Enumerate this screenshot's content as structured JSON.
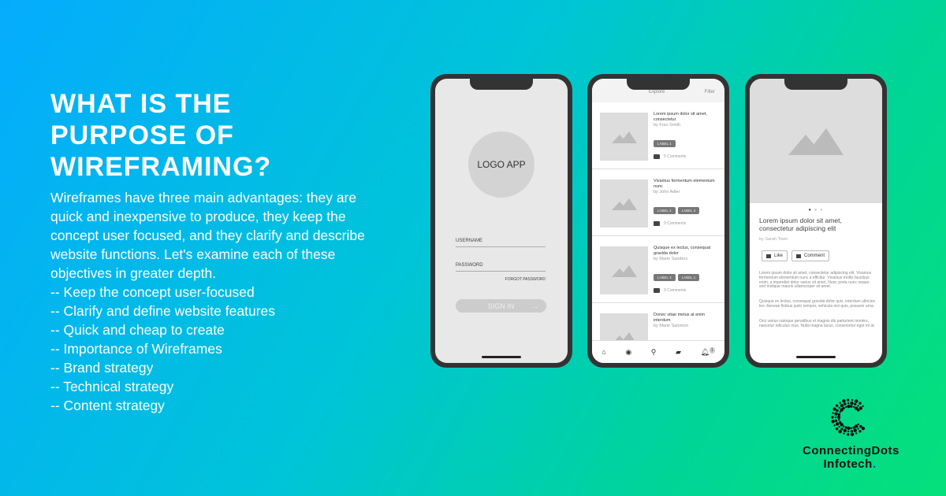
{
  "heading": "What is the purpose of wireframing?",
  "intro": "Wireframes have three main advantages: they are quick and inexpensive to produce, they keep the concept user focused, and they clarify and describe website functions. Let's examine each of these objectives in greater depth.",
  "points": [
    "-- Keep the concept user-focused",
    "-- Clarify and define website features",
    "-- Quick and cheap to create",
    "-- Importance of Wireframes",
    "-- Brand strategy",
    "-- Technical strategy",
    "-- Content strategy"
  ],
  "phone1": {
    "logo": "LOGO APP",
    "username": "USERNAME",
    "password": "PASSWORD",
    "forgot": "FORGOT PASSWORD",
    "signin": "SIGN IN",
    "arrow": "→"
  },
  "phone2": {
    "tab": "Explore",
    "filter": "Filter",
    "cards": [
      {
        "title": "Lorem ipsum dolor sit amet, consectetur",
        "by": "by Fran Smith",
        "labels": [
          "LABEL 1"
        ],
        "comments": "5 Comments"
      },
      {
        "title": "Vivamus fermentum elementum nunc",
        "by": "by John Adler",
        "labels": [
          "LABEL 2",
          "LABEL 3"
        ],
        "comments": "0 Comments"
      },
      {
        "title": "Quisque ex lectus, consequat gravida dolor",
        "by": "by Marie Sanders",
        "labels": [
          "LABEL 3",
          "LABEL 1"
        ],
        "comments": "0 Comments"
      },
      {
        "title": "Donec vitae metus at enim interdum",
        "by": "by Marie Salomon",
        "labels": [
          "",
          ""
        ],
        "comments": ""
      }
    ],
    "badge": "1"
  },
  "phone3": {
    "title": "Lorem ipsum dolor sit amet, consectetur adipiscing elit",
    "by": "by Sarah Town",
    "like": "Like",
    "comment": "Comment",
    "paragraphs": [
      "Lorem ipsum dolor sit amet, consectetur adipiscing elit. Vivamus fermentum elementum nunc a efficitur. Vivamus mollis faucibus enim, a imperdiet dolor varius sit amet. Nunc porta nunc neque, sed tristique mauris ullamcorper sit amet.",
      "Quisque ex lectus, consequat gravida dolor quis, interdum ultricies leo. Aenean finibus justo semper, vehicula nisi quis, posuere urna.",
      "Orci varius natoque penatibus et magnis dis parturient montes, nascetur ridiculus mus. Nulla magna lacus, consectetur eget mi at."
    ]
  },
  "brand": {
    "line1": "ConnectingDots",
    "line2": "Infotech",
    "dot": "."
  },
  "colors": {
    "gradient_start": "#05acfd",
    "gradient_end": "#06e07a",
    "bezel": "#333333"
  }
}
